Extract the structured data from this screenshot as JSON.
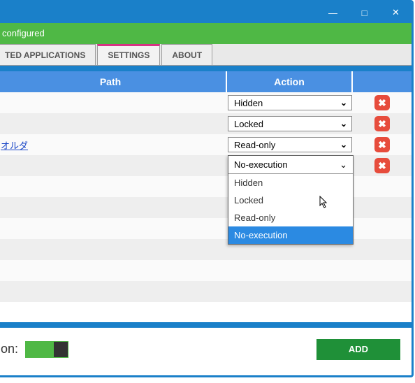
{
  "titlebar": {
    "minimize": "—",
    "maximize": "□",
    "close": "✕"
  },
  "banner": {
    "text": "configured"
  },
  "tabs": {
    "t1": "TED APPLICATIONS",
    "t2": "SETTINGS",
    "t3": "ABOUT"
  },
  "headers": {
    "path": "Path",
    "action": "Action"
  },
  "rows": [
    {
      "path": "",
      "action": "Hidden"
    },
    {
      "path": "",
      "action": "Locked"
    },
    {
      "path": "オルダ",
      "action": "Read-only"
    },
    {
      "path": "",
      "action": "No-execution"
    }
  ],
  "dropdown": {
    "selected": "No-execution",
    "options": [
      "Hidden",
      "Locked",
      "Read-only",
      "No-execution"
    ],
    "highlighted": "No-execution"
  },
  "footer": {
    "label": "on:",
    "add": "ADD"
  }
}
